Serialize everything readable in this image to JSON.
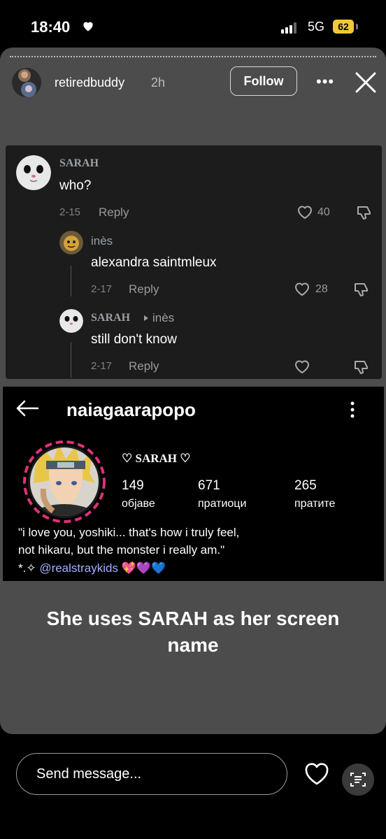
{
  "status": {
    "time": "18:40",
    "network": "5G",
    "battery": "62"
  },
  "story": {
    "username": "retiredbuddy",
    "time": "2h",
    "follow_label": "Follow"
  },
  "comments": [
    {
      "name": "SARAH",
      "text": "who?",
      "date": "2-15",
      "reply": "Reply",
      "likes": "40"
    },
    {
      "name": "inès",
      "text": "alexandra saintmleux",
      "date": "2-17",
      "reply": "Reply",
      "likes": "28"
    },
    {
      "name": "SARAH",
      "reply_to": "inès",
      "text": "still don't know",
      "date": "2-17",
      "reply": "Reply",
      "likes": ""
    }
  ],
  "profile": {
    "username": "naiagaarapopo",
    "display_name": "♡ SARAH ♡",
    "stats": [
      {
        "value": "149",
        "label": "објаве"
      },
      {
        "value": "671",
        "label": "пратиоци"
      },
      {
        "value": "265",
        "label": "пратите"
      }
    ],
    "bio_line1": "\"i love you, yoshiki... that's how i truly feel,",
    "bio_line2": "not hikaru, but the monster i really am.\"",
    "bio_prefix": "*.✧ ",
    "bio_link": "@realstraykids",
    "bio_emoji": "💖💜💙"
  },
  "caption": "She uses SARAH as her screen name",
  "composer": {
    "placeholder": "Send message..."
  },
  "colors": {
    "story_bg": "#4c4c4c",
    "battery": "#f0c838",
    "link": "#a4b0ff",
    "ring": "#e0307a"
  }
}
